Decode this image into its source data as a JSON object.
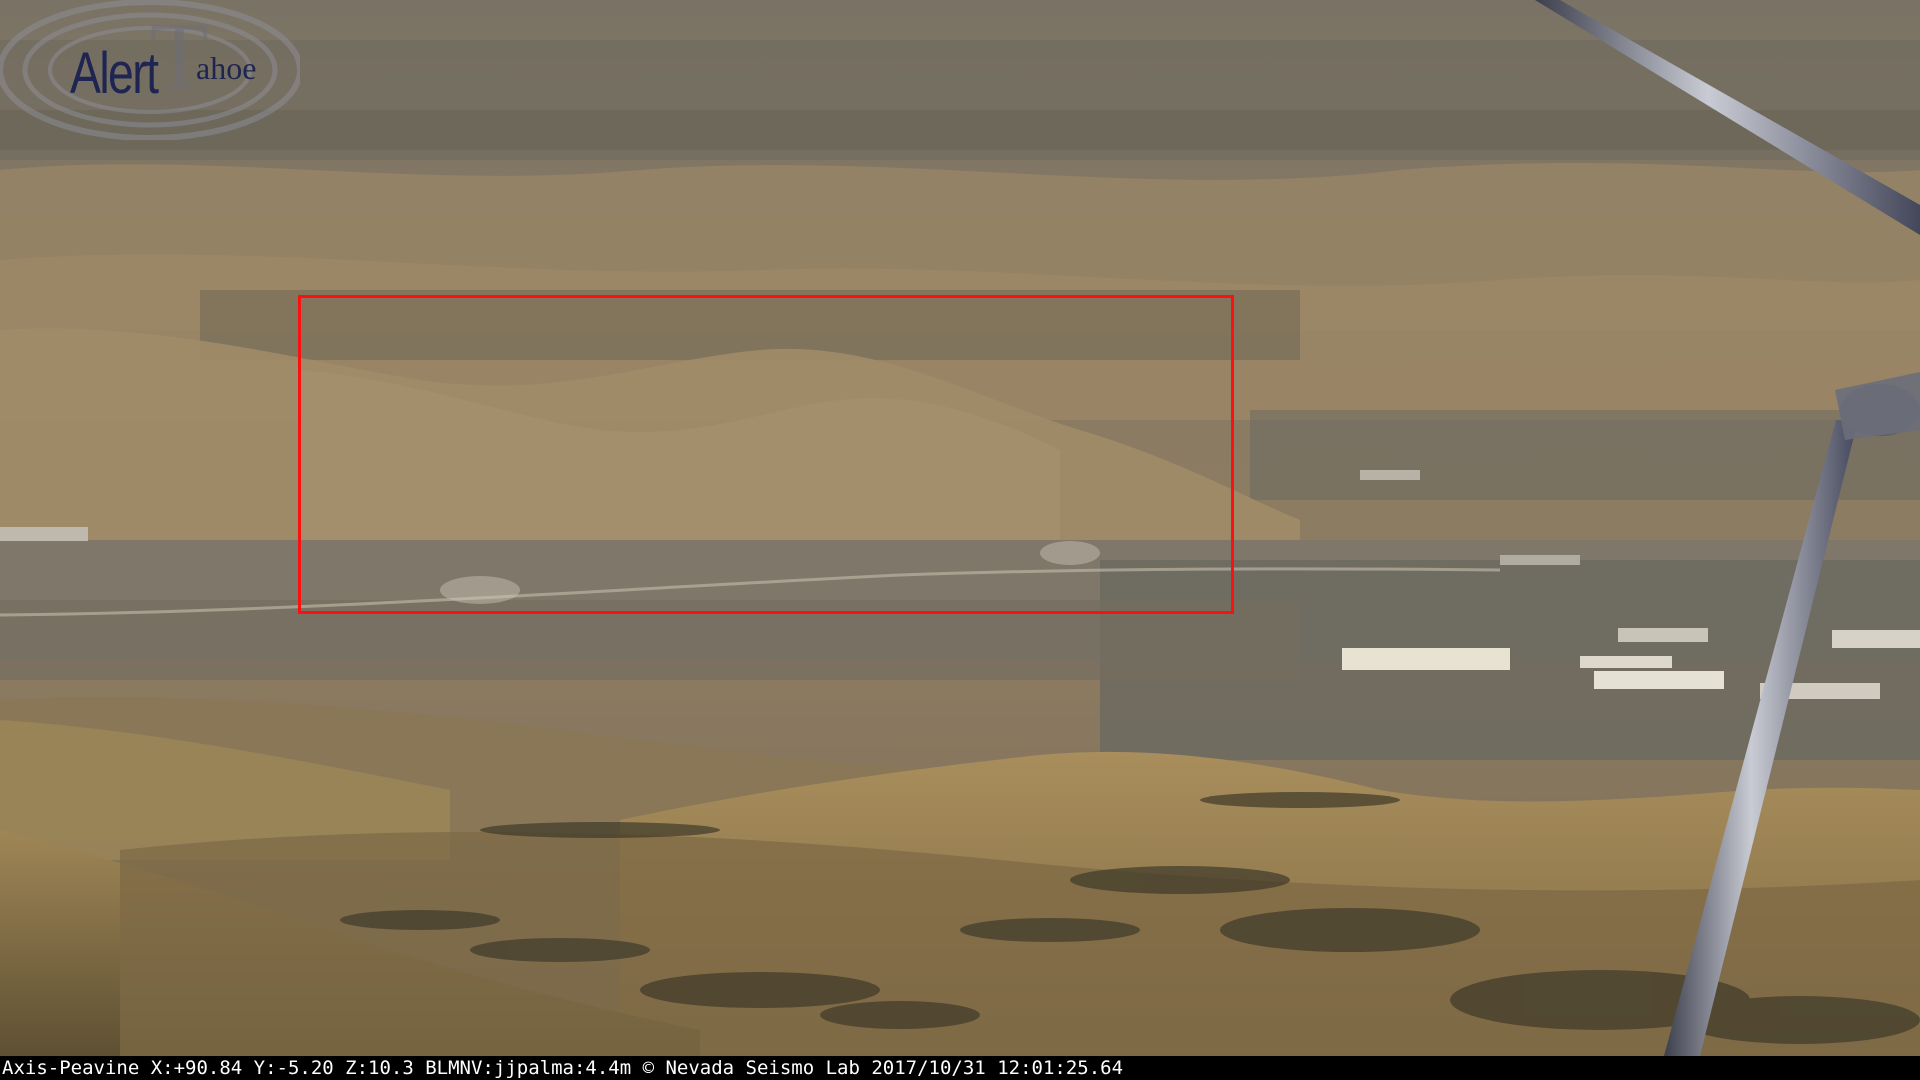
{
  "logo": {
    "word": "Alert",
    "big_letter": "T",
    "tail": "ahoe"
  },
  "overlay": {
    "caption": "Axis-Peavine X:+90.84 Y:-5.20 Z:10.3 BLMNV:jjpalma:4.4m © Nevada Seismo Lab 2017/10/31 12:01:25.64"
  },
  "colors": {
    "alert_box": "#ff1010",
    "logo_text": "#1e2552",
    "status_bar_bg": "#000000",
    "status_bar_text": "#ffffff"
  },
  "icons": {
    "logo_rings": "radio-signal-rings-icon"
  }
}
